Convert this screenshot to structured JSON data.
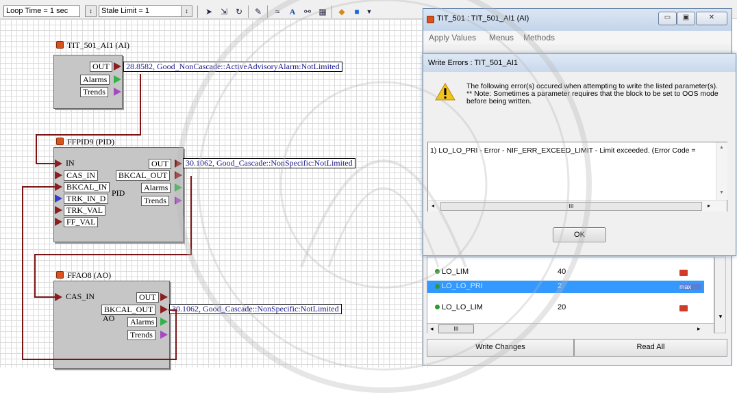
{
  "toolbar": {
    "loop_time": "Loop Time = 1 sec",
    "stale_limit": "Stale Limit = 1"
  },
  "blocks": {
    "ai": {
      "title": "TIT_501_AI1 (AI)",
      "out": "OUT",
      "alarms": "Alarms",
      "trends": "Trends",
      "value": "28.8582, Good_NonCascade::ActiveAdvisoryAlarm:NotLimited"
    },
    "pid": {
      "title": "FFPID9 (PID)",
      "in": "IN",
      "cas_in": "CAS_IN",
      "bkcal_in": "BKCAL_IN",
      "trk_in_d": "TRK_IN_D",
      "trk_val": "TRK_VAL",
      "ff_val": "FF_VAL",
      "out": "OUT",
      "bkcal_out": "BKCAL_OUT",
      "alarms": "Alarms",
      "trends": "Trends",
      "center": "PID",
      "value": "30.1062, Good_Cascade::NonSpecific:NotLimited"
    },
    "ao": {
      "title": "FFAO8 (AO)",
      "cas_in": "CAS_IN",
      "out": "OUT",
      "bkcal_out": "BKCAL_OUT",
      "alarms": "Alarms",
      "trends": "Trends",
      "center": "AO",
      "value": "30.1062, Good_Cascade::NonSpecific:NotLimited"
    }
  },
  "window": {
    "title": "TIT_501 : TIT_501_AI1 (AI)",
    "menu": [
      "Apply Values",
      "Menus",
      "Methods"
    ]
  },
  "dialog": {
    "title": "Write Errors : TIT_501_AI1",
    "message": "The following error(s) occured when attempting to write the listed parameter(s).",
    "note": "** Note: Sometimes a parameter requires that the block to be set to OOS mode before being written.",
    "error": "1) LO_LO_PRI - Error - NIF_ERR_EXCEED_LIMIT - Limit exceeded. (Error Code =",
    "ok_label": "OK",
    "scroll_thumb": "III"
  },
  "params": [
    {
      "name": "LO_LIM",
      "value": "40",
      "tag": "",
      "selected": false
    },
    {
      "name": "LO_LO_PRI",
      "value": "2",
      "tag": "max",
      "selected": true
    },
    {
      "name": "LO_LO_LIM",
      "value": "20",
      "tag": "",
      "selected": false
    }
  ],
  "list_scroll_thumb": "III",
  "buttons": {
    "write_changes": "Write Changes",
    "read_all": "Read All"
  }
}
